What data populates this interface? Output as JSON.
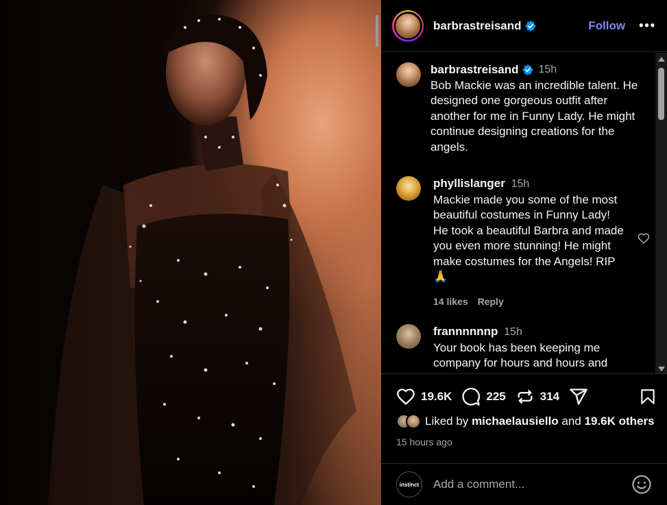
{
  "post": {
    "username": "barbrastreisand",
    "follow_label": "Follow",
    "more_label": "•••"
  },
  "caption": {
    "username": "barbrastreisand",
    "time": "15h",
    "text": "Bob Mackie was an incredible talent. He designed one gorgeous outfit after another for me in Funny Lady. He might continue designing creations for the angels."
  },
  "comments": [
    {
      "username": "phyllislanger",
      "time": "15h",
      "text": "Mackie made you some of the most beautiful costumes in Funny Lady! He took a beautiful Barbra and made you even more stunning! He might make costumes for the Angels! RIP 🙏",
      "likes": "14 likes",
      "reply_label": "Reply"
    },
    {
      "username": "frannnnnnp",
      "time": "15h",
      "text": "Your book has been keeping me company for hours and hours and"
    }
  ],
  "actions": {
    "likes_count": "19.6K",
    "comments_count": "225",
    "reposts_count": "314"
  },
  "liked_by": {
    "prefix": "Liked by",
    "user": "michaelausiello",
    "and": "and",
    "others": "19.6K others"
  },
  "timestamp": "15 hours ago",
  "comment_box": {
    "avatar_label": "instinct",
    "placeholder": "Add a comment..."
  },
  "icons": {
    "verified": "verified-badge-icon",
    "heart": "heart-icon",
    "comment": "comment-icon",
    "repost": "repost-icon",
    "share": "share-icon",
    "save": "bookmark-icon",
    "emoji": "emoji-icon"
  },
  "colors": {
    "follow": "#7e8bf6",
    "verified": "#0095f6",
    "background": "#000000",
    "muted": "#a8a8a8"
  }
}
